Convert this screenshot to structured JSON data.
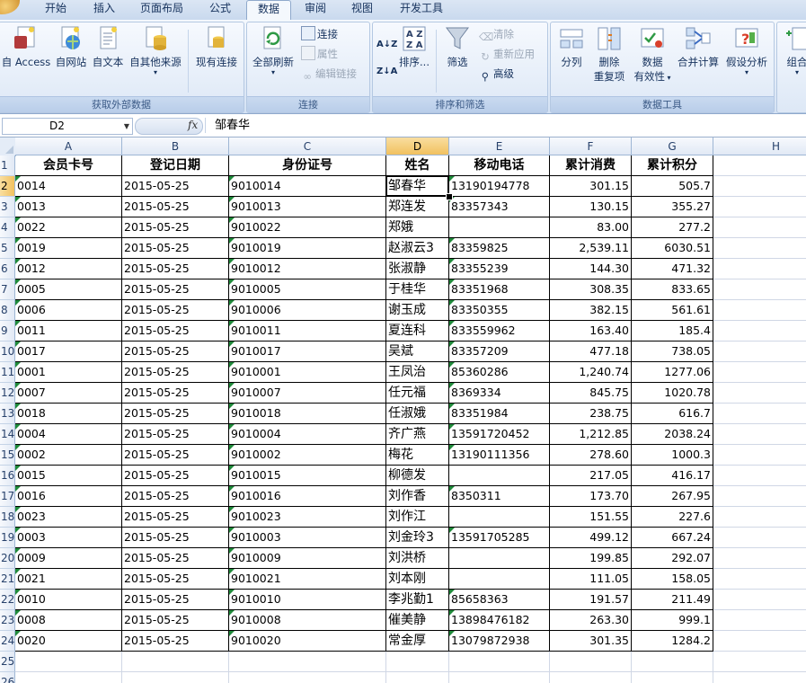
{
  "tabs": [
    "开始",
    "插入",
    "页面布局",
    "公式",
    "数据",
    "审阅",
    "视图",
    "开发工具"
  ],
  "active_tab": "数据",
  "ribbon": {
    "groups": {
      "external": "获取外部数据",
      "connections": "连接",
      "sort_filter": "排序和筛选",
      "data_tools": "数据工具"
    },
    "buttons": {
      "access": "自 Access",
      "web": "自网站",
      "text": "自文本",
      "other": "自其他来源",
      "existing": "现有连接",
      "refresh_all": "全部刷新",
      "connections": "连接",
      "properties": "属性",
      "edit_links": "编辑链接",
      "sort": "排序...",
      "filter": "筛选",
      "clear": "清除",
      "reapply": "重新应用",
      "advanced": "高级",
      "text_to_columns": "分列",
      "remove_dup_1": "删除",
      "remove_dup_2": "重复项",
      "validation_1": "数据",
      "validation_2": "有效性",
      "consolidate": "合并计算",
      "whatif": "假设分析",
      "group": "组合"
    }
  },
  "formula_bar": {
    "name_box": "D2",
    "fx": "fx",
    "content": "邹春华"
  },
  "columns": [
    "A",
    "B",
    "C",
    "D",
    "E",
    "F",
    "G",
    "H"
  ],
  "selected_cell": {
    "col": "D",
    "row": 2
  },
  "header_row": [
    "会员卡号",
    "登记日期",
    "身份证号",
    "姓名",
    "移动电话",
    "累计消费",
    "累计积分"
  ],
  "rows": [
    [
      "0014",
      "2015-05-25",
      "9010014",
      "邹春华",
      "13190194778",
      "301.15",
      "505.7"
    ],
    [
      "0013",
      "2015-05-25",
      "9010013",
      "郑连发",
      "83357343",
      "130.15",
      "355.27"
    ],
    [
      "0022",
      "2015-05-25",
      "9010022",
      "郑娥",
      "",
      "83.00",
      "277.2"
    ],
    [
      "0019",
      "2015-05-25",
      "9010019",
      "赵淑云3",
      "83359825",
      "2,539.11",
      "6030.51"
    ],
    [
      "0012",
      "2015-05-25",
      "9010012",
      "张淑静",
      "83355239",
      "144.30",
      "471.32"
    ],
    [
      "0005",
      "2015-05-25",
      "9010005",
      "于桂华",
      "83351968",
      "308.35",
      "833.65"
    ],
    [
      "0006",
      "2015-05-25",
      "9010006",
      "谢玉成",
      "83350355",
      "382.15",
      "561.61"
    ],
    [
      "0011",
      "2015-05-25",
      "9010011",
      "夏连科",
      "833559962",
      "163.40",
      "185.4"
    ],
    [
      "0017",
      "2015-05-25",
      "9010017",
      "吴斌",
      "83357209",
      "477.18",
      "738.05"
    ],
    [
      "0001",
      "2015-05-25",
      "9010001",
      "王凤治",
      "85360286",
      "1,240.74",
      "1277.06"
    ],
    [
      "0007",
      "2015-05-25",
      "9010007",
      "任元福",
      "8369334",
      "845.75",
      "1020.78"
    ],
    [
      "0018",
      "2015-05-25",
      "9010018",
      "任淑娥",
      "83351984",
      "238.75",
      "616.7"
    ],
    [
      "0004",
      "2015-05-25",
      "9010004",
      "齐广燕",
      "13591720452",
      "1,212.85",
      "2038.24"
    ],
    [
      "0002",
      "2015-05-25",
      "9010002",
      "梅花",
      "13190111356",
      "278.60",
      "1000.3"
    ],
    [
      "0015",
      "2015-05-25",
      "9010015",
      "柳德发",
      "",
      "217.05",
      "416.17"
    ],
    [
      "0016",
      "2015-05-25",
      "9010016",
      "刘作香",
      "8350311",
      "173.70",
      "267.95"
    ],
    [
      "0023",
      "2015-05-25",
      "9010023",
      "刘作江",
      "",
      "151.55",
      "227.6"
    ],
    [
      "0003",
      "2015-05-25",
      "9010003",
      "刘金玲3",
      "13591705285",
      "499.12",
      "667.24"
    ],
    [
      "0009",
      "2015-05-25",
      "9010009",
      "刘洪桥",
      "",
      "199.85",
      "292.07"
    ],
    [
      "0021",
      "2015-05-25",
      "9010021",
      "刘本刚",
      "",
      "111.05",
      "158.05"
    ],
    [
      "0010",
      "2015-05-25",
      "9010010",
      "李兆勤1",
      "85658363",
      "191.57",
      "211.49"
    ],
    [
      "0008",
      "2015-05-25",
      "9010008",
      "催美静",
      "13898476182",
      "263.30",
      "999.1"
    ],
    [
      "0020",
      "2015-05-25",
      "9010020",
      "常金厚",
      "13079872938",
      "301.35",
      "1284.2"
    ]
  ],
  "row_numbers": [
    "1",
    "2",
    "3",
    "4",
    "5",
    "6",
    "7",
    "8",
    "9",
    "10",
    "11",
    "12",
    "13",
    "14",
    "15",
    "16",
    "17",
    "18",
    "19",
    "20",
    "21",
    "22",
    "23",
    "24",
    "25",
    "26"
  ],
  "colors": {
    "accent": "#f1c15f",
    "ribbon_text": "#15315c",
    "error_marker": "#1f8a3a"
  }
}
